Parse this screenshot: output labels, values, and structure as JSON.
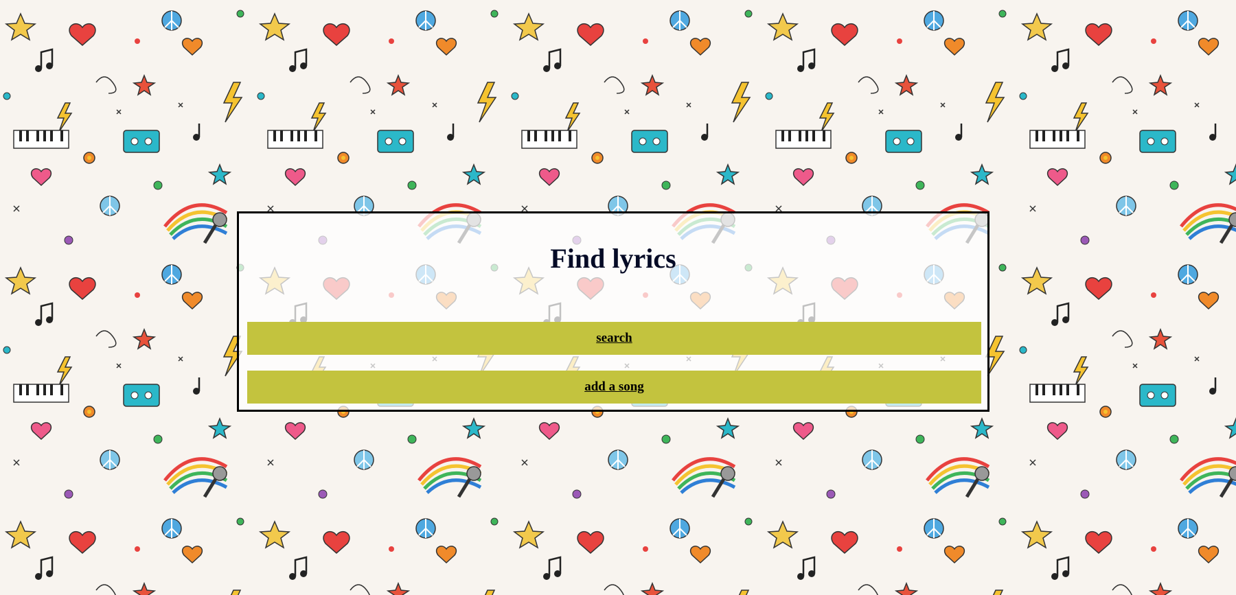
{
  "page": {
    "title": "Find lyrics"
  },
  "actions": {
    "search_label": "search",
    "add_song_label": "add a song"
  },
  "colors": {
    "button_background": "#c3c33e",
    "panel_border": "#000000",
    "title_text": "#050b26"
  },
  "background": {
    "icon_names": [
      "music-doodle-icon",
      "star-icon",
      "heart-icon",
      "peace-icon",
      "lightning-icon",
      "cassette-icon",
      "piano-icon",
      "microphone-icon",
      "headphones-icon"
    ]
  }
}
